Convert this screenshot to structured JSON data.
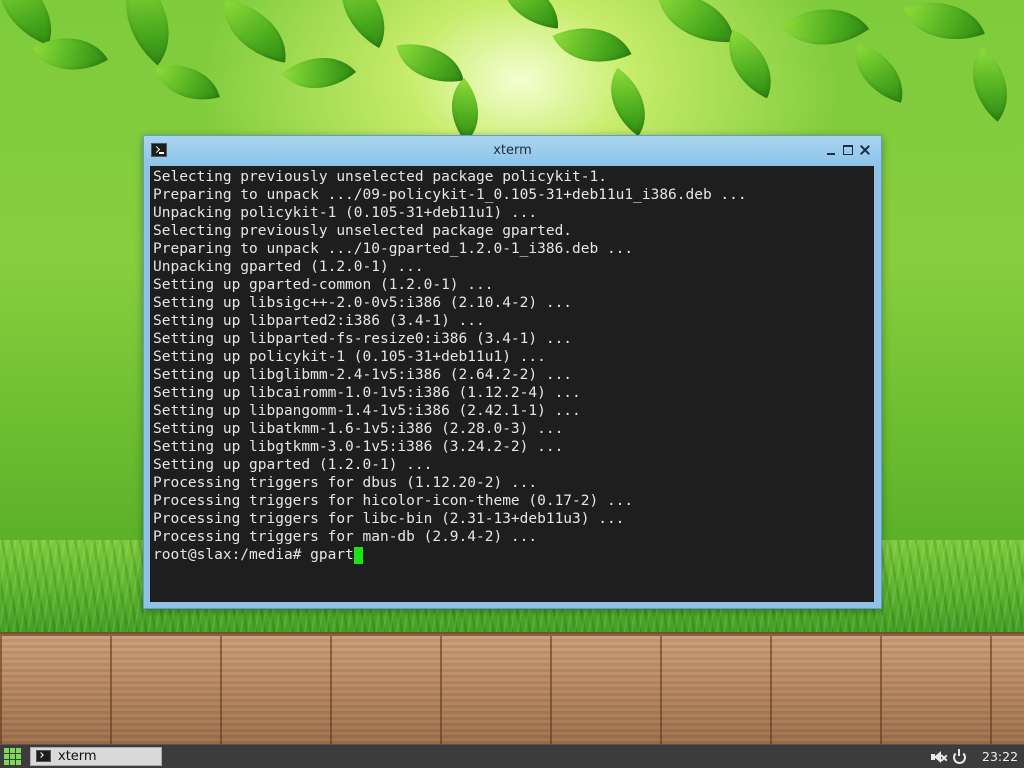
{
  "window": {
    "title": "xterm",
    "icon": "terminal-icon",
    "controls": {
      "minimize": "minimize-icon",
      "maximize": "maximize-icon",
      "close": "close-icon"
    }
  },
  "terminal": {
    "lines": [
      "Selecting previously unselected package policykit-1.",
      "Preparing to unpack .../09-policykit-1_0.105-31+deb11u1_i386.deb ...",
      "Unpacking policykit-1 (0.105-31+deb11u1) ...",
      "Selecting previously unselected package gparted.",
      "Preparing to unpack .../10-gparted_1.2.0-1_i386.deb ...",
      "Unpacking gparted (1.2.0-1) ...",
      "Setting up gparted-common (1.2.0-1) ...",
      "Setting up libsigc++-2.0-0v5:i386 (2.10.4-2) ...",
      "Setting up libparted2:i386 (3.4-1) ...",
      "Setting up libparted-fs-resize0:i386 (3.4-1) ...",
      "Setting up policykit-1 (0.105-31+deb11u1) ...",
      "Setting up libglibmm-2.4-1v5:i386 (2.64.2-2) ...",
      "Setting up libcairomm-1.0-1v5:i386 (1.12.2-4) ...",
      "Setting up libpangomm-1.4-1v5:i386 (2.42.1-1) ...",
      "Setting up libatkmm-1.6-1v5:i386 (2.28.0-3) ...",
      "Setting up libgtkmm-3.0-1v5:i386 (3.24.2-2) ...",
      "Setting up gparted (1.2.0-1) ...",
      "Processing triggers for dbus (1.12.20-2) ...",
      "Processing triggers for hicolor-icon-theme (0.17-2) ...",
      "Processing triggers for libc-bin (2.31-13+deb11u3) ...",
      "Processing triggers for man-db (2.9.4-2) ..."
    ],
    "prompt": "root@slax:/media# ",
    "current_input": "gpart",
    "colors": {
      "background": "#1e1e1e",
      "text": "#e6e6e6",
      "cursor": "#19e619"
    }
  },
  "taskbar": {
    "start_icon": "app-grid-icon",
    "tasks": [
      {
        "label": "xterm",
        "icon": "terminal-icon"
      }
    ],
    "tray": {
      "volume_icon": "volume-muted-icon",
      "power_icon": "power-icon",
      "clock": "23:22"
    }
  }
}
